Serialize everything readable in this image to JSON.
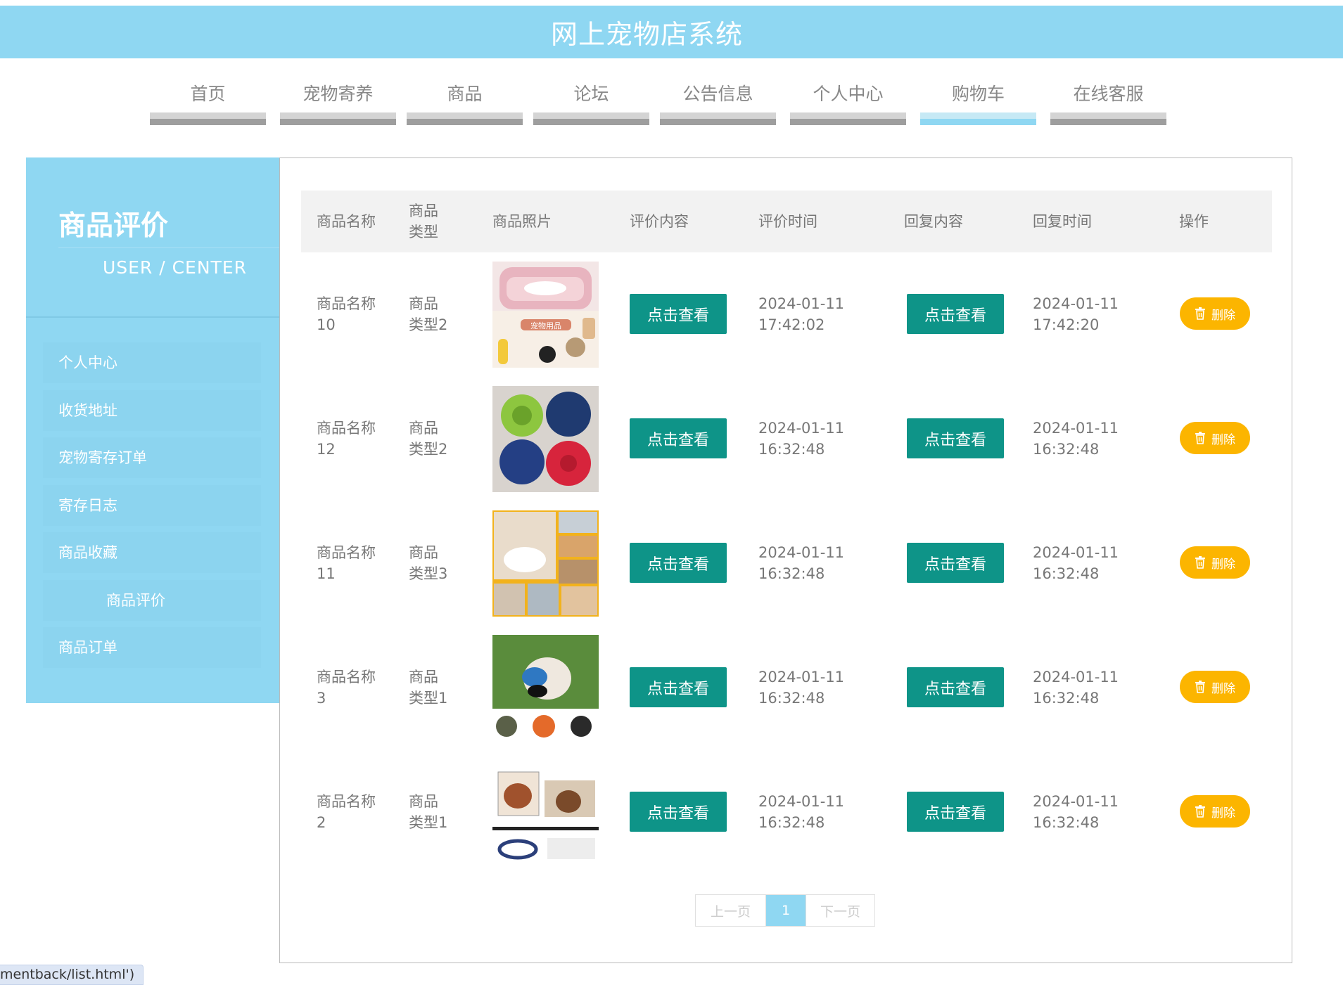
{
  "header": {
    "title": "网上宠物店系统"
  },
  "nav": [
    {
      "label": "首页"
    },
    {
      "label": "宠物寄养"
    },
    {
      "label": "商品"
    },
    {
      "label": "论坛"
    },
    {
      "label": "公告信息"
    },
    {
      "label": "个人中心"
    },
    {
      "label": "购物车",
      "active": true
    },
    {
      "label": "在线客服"
    }
  ],
  "sidebar": {
    "title": "商品评价",
    "subtitle": "USER / CENTER",
    "items": [
      {
        "label": "个人中心"
      },
      {
        "label": "收货地址"
      },
      {
        "label": "宠物寄存订单"
      },
      {
        "label": "寄存日志"
      },
      {
        "label": "商品收藏"
      },
      {
        "label": "商品评价",
        "active": true
      },
      {
        "label": "商品订单"
      }
    ]
  },
  "table": {
    "headers": [
      "商品名称",
      "商品类型",
      "商品照片",
      "评价内容",
      "评价时间",
      "回复内容",
      "回复时间",
      "操作"
    ],
    "view_label": "点击查看",
    "delete_label": "删除",
    "rows": [
      {
        "name": "商品名称10",
        "type": "商品类型2",
        "photo": "pet-sofa-product-photo",
        "eval_date": "2024-01-11",
        "eval_time": "17:42:02",
        "reply_date": "2024-01-11",
        "reply_time": "17:42:20"
      },
      {
        "name": "商品名称12",
        "type": "商品类型2",
        "photo": "pet-bowls-product-photo",
        "eval_date": "2024-01-11",
        "eval_time": "16:32:48",
        "reply_date": "2024-01-11",
        "reply_time": "16:32:48"
      },
      {
        "name": "商品名称11",
        "type": "商品类型3",
        "photo": "pet-feeder-product-photo",
        "eval_date": "2024-01-11",
        "eval_time": "16:32:48",
        "reply_date": "2024-01-11",
        "reply_time": "16:32:48"
      },
      {
        "name": "商品名称3",
        "type": "商品类型1",
        "photo": "dog-muzzle-product-photo",
        "eval_date": "2024-01-11",
        "eval_time": "16:32:48",
        "reply_date": "2024-01-11",
        "reply_time": "16:32:48"
      },
      {
        "name": "商品名称2",
        "type": "商品类型1",
        "photo": "dog-collar-product-photo",
        "eval_date": "2024-01-11",
        "eval_time": "16:32:48",
        "reply_date": "2024-01-11",
        "reply_time": "16:32:48"
      }
    ]
  },
  "pagination": {
    "prev": "上一页",
    "current": "1",
    "next": "下一页"
  },
  "statusbar": {
    "text": "mentback/list.html')"
  },
  "colors": {
    "brand": "#8fd7f2",
    "view_button": "#0e9488",
    "delete_button": "#fcb500"
  }
}
